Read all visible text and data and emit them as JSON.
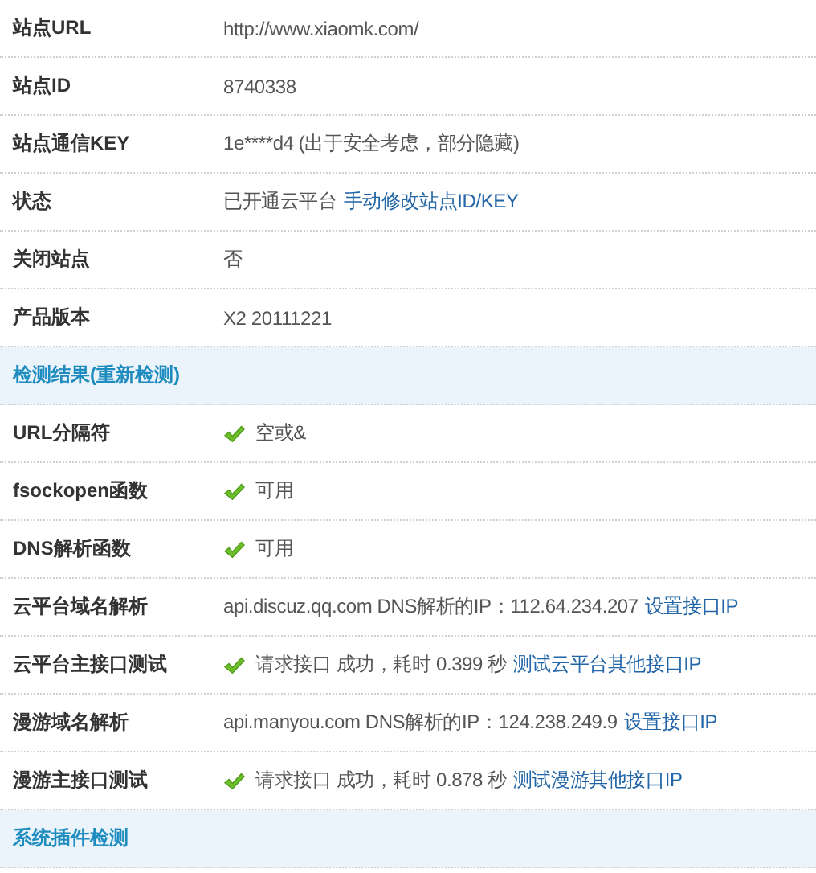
{
  "rows": [
    {
      "kind": "row",
      "label": "站点URL",
      "value": [
        {
          "kind": "text",
          "text": "http://www.xiaomk.com/"
        }
      ]
    },
    {
      "kind": "row",
      "label": "站点ID",
      "value": [
        {
          "kind": "text",
          "text": "8740338"
        }
      ]
    },
    {
      "kind": "row",
      "label": "站点通信KEY",
      "value": [
        {
          "kind": "text",
          "text": "1e****d4 (出于安全考虑，部分隐藏)"
        }
      ]
    },
    {
      "kind": "row",
      "label": "状态",
      "value": [
        {
          "kind": "text",
          "text": "已开通云平台"
        },
        {
          "kind": "link",
          "text": "手动修改站点ID/KEY"
        }
      ]
    },
    {
      "kind": "row",
      "label": "关闭站点",
      "value": [
        {
          "kind": "text",
          "text": "否"
        }
      ]
    },
    {
      "kind": "row",
      "label": "产品版本",
      "value": [
        {
          "kind": "text",
          "text": "X2 20111221"
        }
      ]
    },
    {
      "kind": "section",
      "label": "检测结果(重新检测)"
    },
    {
      "kind": "row",
      "label": "URL分隔符",
      "ok": true,
      "value": [
        {
          "kind": "text",
          "text": "空或&"
        }
      ]
    },
    {
      "kind": "row",
      "label": "fsockopen函数",
      "ok": true,
      "value": [
        {
          "kind": "text",
          "text": "可用"
        }
      ]
    },
    {
      "kind": "row",
      "label": "DNS解析函数",
      "ok": true,
      "value": [
        {
          "kind": "text",
          "text": "可用"
        }
      ]
    },
    {
      "kind": "row",
      "label": "云平台域名解析",
      "value": [
        {
          "kind": "text",
          "text": "api.discuz.qq.com DNS解析的IP：112.64.234.207"
        },
        {
          "kind": "link",
          "text": "设置接口IP"
        }
      ]
    },
    {
      "kind": "row",
      "label": "云平台主接口测试",
      "ok": true,
      "value": [
        {
          "kind": "text",
          "text": "请求接口 成功，耗时 0.399 秒"
        },
        {
          "kind": "link",
          "text": "测试云平台其他接口IP"
        }
      ]
    },
    {
      "kind": "row",
      "label": "漫游域名解析",
      "value": [
        {
          "kind": "text",
          "text": "api.manyou.com DNS解析的IP：124.238.249.9"
        },
        {
          "kind": "link",
          "text": "设置接口IP"
        }
      ]
    },
    {
      "kind": "row",
      "label": "漫游主接口测试",
      "ok": true,
      "value": [
        {
          "kind": "text",
          "text": "请求接口 成功，耗时 0.878 秒"
        },
        {
          "kind": "link",
          "text": "测试漫游其他接口IP"
        }
      ]
    },
    {
      "kind": "section",
      "label": "系统插件检测"
    }
  ]
}
